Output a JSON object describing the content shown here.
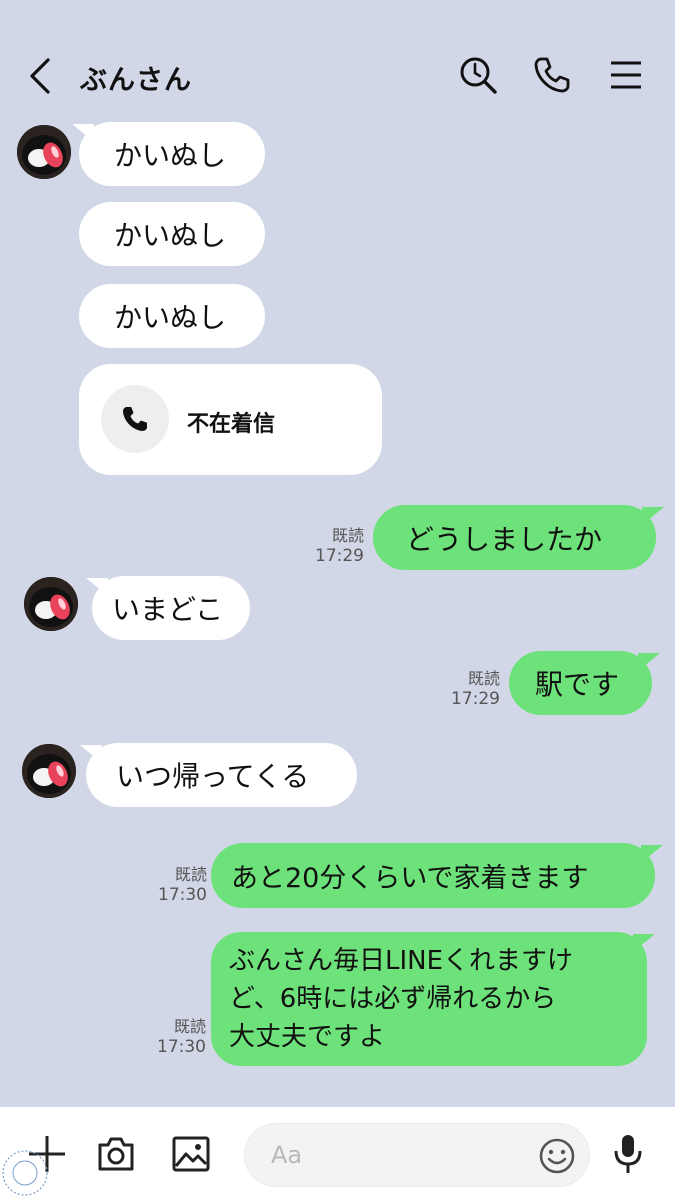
{
  "header": {
    "title": "ぶんさん",
    "back_icon": "chevron-left-icon",
    "search_icon": "search-icon",
    "call_icon": "phone-icon",
    "menu_icon": "hamburger-menu-icon"
  },
  "messages": {
    "m1": "かいぬし",
    "m2": "かいぬし",
    "m3": "かいぬし",
    "missed_call": "不在着信",
    "m5": {
      "text": "どうしましたか",
      "read": "既読",
      "time": "17:29"
    },
    "m6": "いまどこ",
    "m7": {
      "text": "駅です",
      "read": "既読",
      "time": "17:29"
    },
    "m8": "いつ帰ってくる",
    "m9": {
      "text": "あと20分くらいで家着きます",
      "read": "既読",
      "time": "17:30"
    },
    "m10": {
      "line1": "ぶんさん毎日LINEくれますけ",
      "line2": "ど、6時には必ず帰れるから",
      "line3": "大丈夫ですよ",
      "read": "既読",
      "time": "17:30"
    }
  },
  "composer": {
    "placeholder": "Aa",
    "icons": [
      "plus-icon",
      "camera-icon",
      "image-icon",
      "emoji-icon",
      "microphone-icon"
    ]
  },
  "colors": {
    "background": "#d2d7e7",
    "incoming": "#ffffff",
    "outgoing": "#6ee27a"
  }
}
